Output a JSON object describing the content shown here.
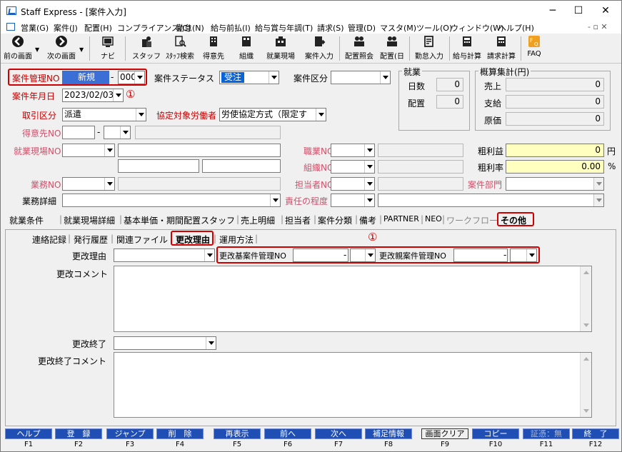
{
  "window": {
    "title": "Staff Express - [案件入力]",
    "minimize": "─",
    "maximize": "☐",
    "close": "✕"
  },
  "menu": {
    "items": [
      "営業(G)",
      "案件(J)",
      "配置(H)",
      "コンプライアンス(C)",
      "勤怠(N)",
      "給与前払(I)",
      "給与賞与年調(T)",
      "請求(S)",
      "管理(D)",
      "マスタ(M)",
      "ツール(O)",
      "ウィンドウ(W)",
      "ヘルプ(H)"
    ],
    "mdi_controls": "- ▫ ✕"
  },
  "toolbar": {
    "prev": "前の画面",
    "next": "次の画面",
    "nav": "ナビ",
    "staff": "スタッフ",
    "staff_search": "ｽﾀｯﾌ検索",
    "client": "得意先",
    "org": "組織",
    "site": "就業現場",
    "case_input": "案件入力",
    "placement_inquiry": "配置照会",
    "placement_day": "配置(日",
    "attendance_input": "勤怠入力",
    "payroll": "給与計算",
    "billing": "請求計算",
    "faq": "FAQ"
  },
  "form": {
    "case_no_label": "案件管理NO",
    "case_no_value": "新規",
    "case_no_dash": "-",
    "case_no_branch": "000",
    "case_status_label": "案件ステータス",
    "case_status_value": "受注",
    "case_category_label": "案件区分",
    "case_category_value": "",
    "case_date_label": "案件年月日",
    "case_date_value": "2023/02/03",
    "marker_1": "①",
    "trade_type_label": "取引区分",
    "trade_type_value": "派遣",
    "agreement_label": "協定対象労働者",
    "agreement_value": "労使協定方式（限定す",
    "client_label": "得意先NO",
    "client_dash": "-",
    "site_label": "就業現場NO",
    "job_label": "業務NO",
    "job_detail_label": "業務詳細",
    "occupation_label": "職業NO",
    "org_label": "組織NO",
    "person_label": "担当者NO",
    "responsibility_label": "責任の程度",
    "dept_label": "案件部門"
  },
  "work": {
    "title": "就業",
    "days_label": "日数",
    "days_value": "0",
    "placement_label": "配置",
    "placement_value": "0"
  },
  "summary": {
    "title": "概算集計(円)",
    "sales_label": "売上",
    "sales_value": "0",
    "payment_label": "支給",
    "payment_value": "0",
    "cost_label": "原価",
    "cost_value": "0",
    "gross_profit_label": "粗利益",
    "gross_profit_value": "0",
    "gross_profit_unit": "円",
    "margin_label": "粗利率",
    "margin_value": "0.00",
    "margin_unit": "%"
  },
  "tabs": {
    "main": [
      "就業条件",
      "就業現場詳細",
      "基本単価・期間配置スタッフ",
      "売上明細",
      "担当者",
      "案件分類",
      "備考",
      "PARTNER",
      "NEO",
      "ワークフロー",
      "その他"
    ],
    "sub": [
      "連絡記録",
      "発行履歴",
      "関連ファイル",
      "更改理由",
      "運用方法"
    ]
  },
  "renewal": {
    "reason_label": "更改理由",
    "base_case_label": "更改基案件管理NO",
    "base_dash": "-",
    "parent_case_label": "更改親案件管理NO",
    "parent_dash": "-",
    "marker_1": "①",
    "comment_label": "更改コメント",
    "end_label": "更改終了",
    "end_comment_label": "更改終了コメント"
  },
  "fkeys": [
    {
      "label": "ヘルプ",
      "key": "F1"
    },
    {
      "label": "登　録",
      "key": "F2"
    },
    {
      "label": "ジャンプ",
      "key": "F3"
    },
    {
      "label": "削　除",
      "key": "F4"
    },
    {
      "label": "再表示",
      "key": "F5"
    },
    {
      "label": "前へ",
      "key": "F6"
    },
    {
      "label": "次へ",
      "key": "F7"
    },
    {
      "label": "補足情報",
      "key": "F8"
    },
    {
      "label": "画面クリア",
      "key": "F9"
    },
    {
      "label": "コピー",
      "key": "F10"
    },
    {
      "label": "証憑：無",
      "key": "F11"
    },
    {
      "label": "終　了",
      "key": "F12"
    }
  ],
  "colors": {
    "fkey_bg": "#1f4fb5",
    "required_label": "#c00000",
    "highlight_box": "#d00000",
    "status_selected": "#0a64d8",
    "case_no_bg": "#3c6fd6"
  }
}
